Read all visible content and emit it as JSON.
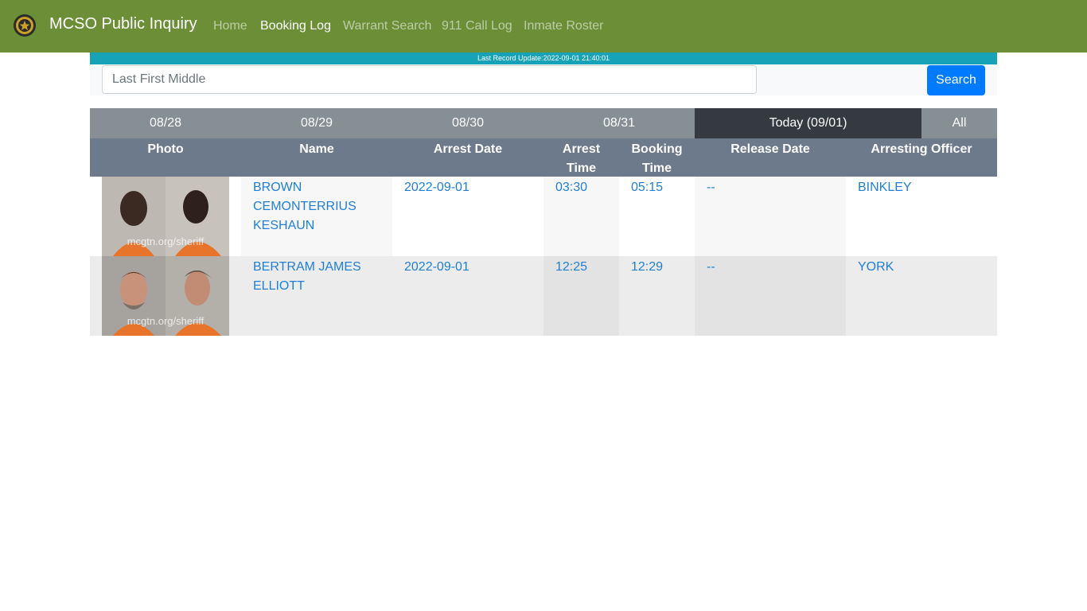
{
  "navbar": {
    "brand": "MCSO Public Inquiry",
    "logo_icon": "sheriff-badge-icon",
    "links": [
      {
        "label": "Home",
        "active": false
      },
      {
        "label": "Booking Log",
        "active": true
      },
      {
        "label": "Warrant Search",
        "active": false
      },
      {
        "label": "911 Call Log",
        "active": false
      },
      {
        "label": "Inmate Roster",
        "active": false
      }
    ],
    "color": "#6b8e37"
  },
  "status": {
    "text": "Last Record Update:2022-09-01 21:40:01",
    "color": "#17a2b8"
  },
  "search": {
    "placeholder": "Last First Middle",
    "value": "",
    "button_label": "Search"
  },
  "date_tabs": [
    {
      "label": "08/28",
      "active": false
    },
    {
      "label": "08/29",
      "active": false
    },
    {
      "label": "08/30",
      "active": false
    },
    {
      "label": "08/31",
      "active": false
    },
    {
      "label": "Today (09/01)",
      "active": true
    },
    {
      "label": "All",
      "active": false
    }
  ],
  "table": {
    "columns": [
      "Photo",
      "Name",
      "Arrest Date",
      "Arrest Time",
      "Booking Time",
      "Release Date",
      "Arresting Officer"
    ],
    "rows": [
      {
        "photo_caption": "mcgtn.org/sheriff",
        "name_lines": [
          "BROWN",
          "CEMONTERRIUS",
          "KESHAUN"
        ],
        "arrest_date": "2022-09-01",
        "arrest_time": "03:30",
        "booking_time": "05:15",
        "release_date": "--",
        "officer": "BINKLEY"
      },
      {
        "photo_caption": "mcgtn.org/sheriff",
        "name_lines": [
          "BERTRAM JAMES",
          "ELLIOTT"
        ],
        "arrest_date": "2022-09-01",
        "arrest_time": "12:25",
        "booking_time": "12:29",
        "release_date": "--",
        "officer": "YORK"
      }
    ]
  }
}
